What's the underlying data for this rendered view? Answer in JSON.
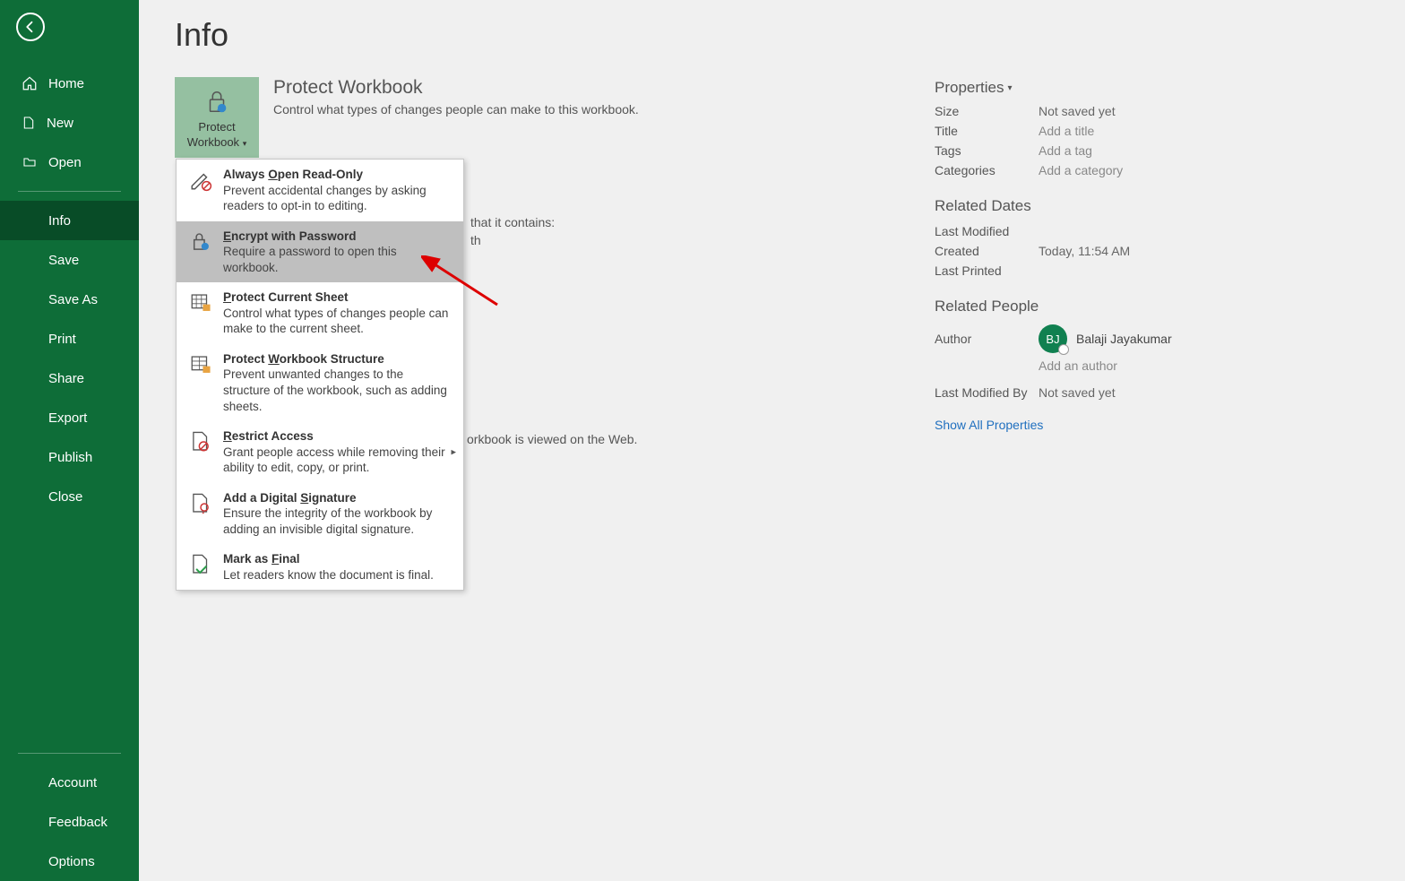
{
  "sidebar": {
    "home": "Home",
    "new": "New",
    "open": "Open",
    "info": "Info",
    "save": "Save",
    "saveas": "Save As",
    "print": "Print",
    "share": "Share",
    "export": "Export",
    "publish": "Publish",
    "close": "Close",
    "account": "Account",
    "feedback": "Feedback",
    "options": "Options"
  },
  "page": {
    "title": "Info"
  },
  "protect": {
    "button_line1": "Protect",
    "button_line2": "Workbook",
    "heading": "Protect Workbook",
    "desc": "Control what types of changes people can make to this workbook."
  },
  "dropdown": {
    "readonly": {
      "title_pre": "Always ",
      "title_u": "O",
      "title_post": "pen Read-Only",
      "desc": "Prevent accidental changes by asking readers to opt-in to editing."
    },
    "encrypt": {
      "title_u": "E",
      "title_post": "ncrypt with Password",
      "desc": "Require a password to open this workbook."
    },
    "sheet": {
      "title_u": "P",
      "title_post": "rotect Current Sheet",
      "desc": "Control what types of changes people can make to the current sheet."
    },
    "structure": {
      "title_pre": "Protect ",
      "title_u": "W",
      "title_post": "orkbook Structure",
      "desc": "Prevent unwanted changes to the structure of the workbook, such as adding sheets."
    },
    "restrict": {
      "title_u": "R",
      "title_post": "estrict Access",
      "desc": "Grant people access while removing their ability to edit, copy, or print."
    },
    "signature": {
      "title_pre": "Add a Digital ",
      "title_u": "S",
      "title_post": "ignature",
      "desc": "Ensure the integrity of the workbook by adding an invisible digital signature."
    },
    "final": {
      "title_pre": "Mark as ",
      "title_u": "F",
      "title_post": "inal",
      "desc": "Let readers know the document is final."
    }
  },
  "behind_text": {
    "frag1": "that it contains:",
    "frag2": "th",
    "frag3": "orkbook is viewed on the Web."
  },
  "properties": {
    "heading": "Properties",
    "size_label": "Size",
    "size_value": "Not saved yet",
    "title_label": "Title",
    "title_value": "Add a title",
    "tags_label": "Tags",
    "tags_value": "Add a tag",
    "categories_label": "Categories",
    "categories_value": "Add a category",
    "related_dates": "Related Dates",
    "modified_label": "Last Modified",
    "modified_value": "",
    "created_label": "Created",
    "created_value": "Today, 11:54 AM",
    "printed_label": "Last Printed",
    "printed_value": "",
    "related_people": "Related People",
    "author_label": "Author",
    "author_initials": "BJ",
    "author_name": "Balaji Jayakumar",
    "add_author": "Add an author",
    "last_modified_by_label": "Last Modified By",
    "last_modified_by_value": "Not saved yet",
    "show_all": "Show All Properties"
  }
}
